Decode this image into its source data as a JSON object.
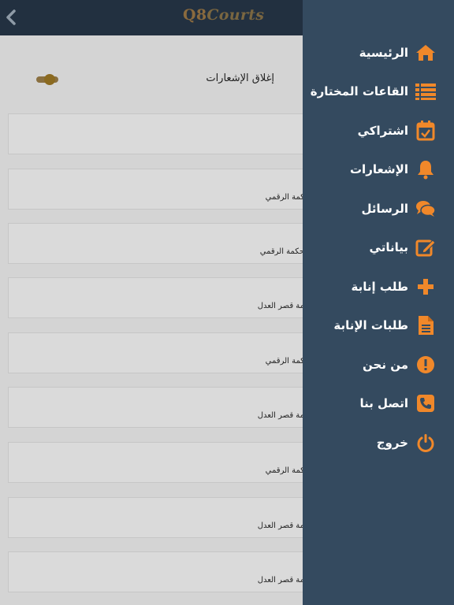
{
  "header": {
    "logo_prefix": "Q8",
    "logo_suffix": "Courts"
  },
  "settings": {
    "notifications_toggle_label": "إغلاق الإشعارات"
  },
  "cards": [
    {
      "text": ""
    },
    {
      "text": "كمة الرقمي"
    },
    {
      "text": "حكمة الرقمي"
    },
    {
      "text": "مة قصر العدل"
    },
    {
      "text": "كمة الرقمي"
    },
    {
      "text": "مة قصر العدل"
    },
    {
      "text": "كمة الرقمي"
    },
    {
      "text": "مة قصر العدل"
    },
    {
      "text": "مة قصر العدل"
    }
  ],
  "drawer": {
    "accent_color": "#f0882a",
    "items": [
      {
        "label": "الرئيسية",
        "icon": "home-icon"
      },
      {
        "label": "القاعات المختارة",
        "icon": "list-icon"
      },
      {
        "label": "اشتراكي",
        "icon": "calendar-check-icon"
      },
      {
        "label": "الإشعارات",
        "icon": "bell-icon"
      },
      {
        "label": "الرسائل",
        "icon": "chat-icon"
      },
      {
        "label": "بياناتي",
        "icon": "edit-icon"
      },
      {
        "label": "طلب إنابة",
        "icon": "plus-icon"
      },
      {
        "label": "طلبات الإنابة",
        "icon": "document-icon"
      },
      {
        "label": "من نحن",
        "icon": "info-icon"
      },
      {
        "label": "اتصل بنا",
        "icon": "phone-icon"
      },
      {
        "label": "خروج",
        "icon": "power-icon"
      }
    ]
  }
}
